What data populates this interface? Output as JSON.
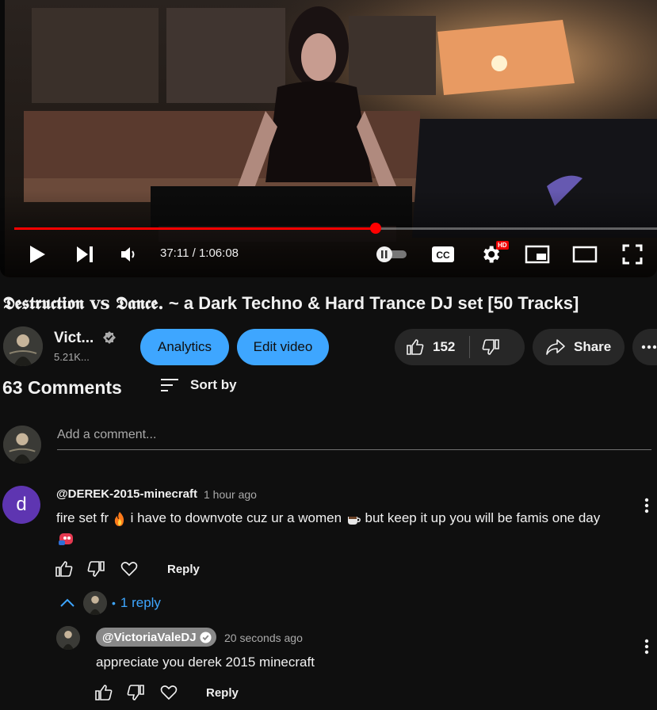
{
  "player": {
    "time_current": "37:11",
    "time_separator": " / ",
    "time_total": "1:06:08",
    "progress_fraction": 0.562,
    "hd_badge": "HD",
    "icons": [
      "play-icon",
      "next-icon",
      "volume-icon",
      "autoplay-toggle",
      "cc-icon",
      "settings-icon",
      "miniplayer-icon",
      "theater-icon",
      "fullscreen-icon"
    ]
  },
  "video": {
    "title_fancy": "𝕯𝖊𝖘𝖙𝖗𝖚𝖈𝖙𝖎𝖔𝖓 vs 𝕯𝖆𝖓𝖈𝖊.",
    "title_rest": " ~ a Dark Techno & Hard Trance DJ set [50 Tracks]"
  },
  "channel": {
    "name": "Vict...",
    "subscribers": "5.21K..."
  },
  "actions": {
    "analytics_label": "Analytics",
    "edit_label": "Edit video",
    "like_count": "152",
    "share_label": "Share"
  },
  "comments": {
    "count_label": "63 Comments",
    "sort_label": "Sort by",
    "add_placeholder": "Add a comment...",
    "items": [
      {
        "avatar_letter": "d",
        "author": "@DEREK-2015-minecraft",
        "time": "1 hour ago",
        "text_part1": "fire set fr ",
        "text_part2": " i have to downvote cuz ur a women ",
        "text_part3": " but keep it up you will be famis one day",
        "reply_label": "Reply",
        "replies_label": "1 reply"
      }
    ],
    "reply": {
      "author": "@VictoriaValeDJ",
      "time": "20 seconds ago",
      "text": "appreciate you derek 2015 minecraft",
      "reply_label": "Reply"
    }
  },
  "colors": {
    "background": "#0f0f0f",
    "accent_blue": "#3ea6ff",
    "progress_red": "#ff0000",
    "chip_dark": "#272727",
    "avatar_purple": "#5e35b1"
  }
}
